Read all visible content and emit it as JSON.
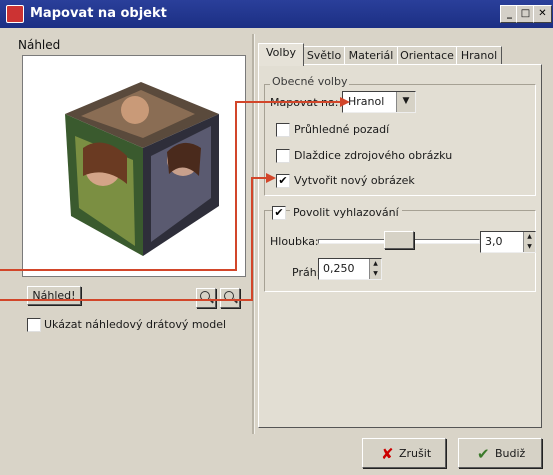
{
  "window": {
    "title": "Mapovat na objekt",
    "min_glyph": "_",
    "max_glyph": "□",
    "close_glyph": "✕"
  },
  "preview": {
    "label": "Náhled",
    "button_label": "Náhled!",
    "wireframe_label": "Ukázat náhledový drátový model",
    "wireframe_checked": false
  },
  "tabs": [
    {
      "label": "Volby",
      "active": true
    },
    {
      "label": "Světlo",
      "active": false
    },
    {
      "label": "Materiál",
      "active": false
    },
    {
      "label": "Orientace",
      "active": false
    },
    {
      "label": "Hranol",
      "active": false
    }
  ],
  "general": {
    "group_title": "Obecné volby",
    "map_to_label": "Mapovat na:",
    "map_to_value": "Hranol",
    "transparent_label": "Průhledné pozadí",
    "transparent_checked": false,
    "tile_label": "Dlaždice zdrojového obrázku",
    "tile_checked": false,
    "new_image_label": "Vytvořit nový obrázek",
    "new_image_checked": true
  },
  "antialias": {
    "label": "Povolit vyhlazování",
    "checked": true,
    "depth_label": "Hloubka:",
    "depth_value": "3,0",
    "threshold_label": "Práh:",
    "threshold_value": "0,250"
  },
  "buttons": {
    "cancel_label": "Zrušit",
    "ok_label": "Budiž"
  },
  "colors": {
    "titlebar": "#1c2f84",
    "annotation": "#d2462a"
  }
}
